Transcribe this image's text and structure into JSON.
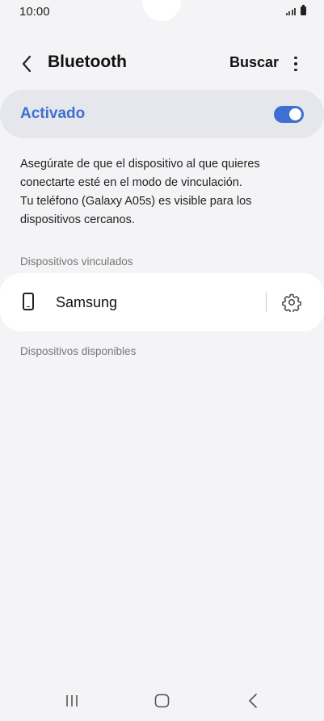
{
  "status_bar": {
    "time": "10:00"
  },
  "app_bar": {
    "title": "Bluetooth",
    "search_label": "Buscar"
  },
  "master_toggle": {
    "label": "Activado",
    "on": true,
    "accent": "#3e6fd1"
  },
  "description": {
    "lines": [
      "Asegúrate de que el dispositivo al que quieres",
      "conectarte esté en el modo de vinculación.",
      "Tu teléfono (Galaxy A05s) es visible para los",
      "dispositivos cercanos."
    ]
  },
  "paired_section": {
    "header": "Dispositivos vinculados",
    "devices": [
      {
        "name": "Samsung",
        "icon": "phone-icon"
      }
    ]
  },
  "available_section": {
    "header": "Dispositivos disponibles"
  },
  "nav_bar": {
    "buttons": [
      "recents-icon",
      "home-icon",
      "back-icon"
    ]
  }
}
